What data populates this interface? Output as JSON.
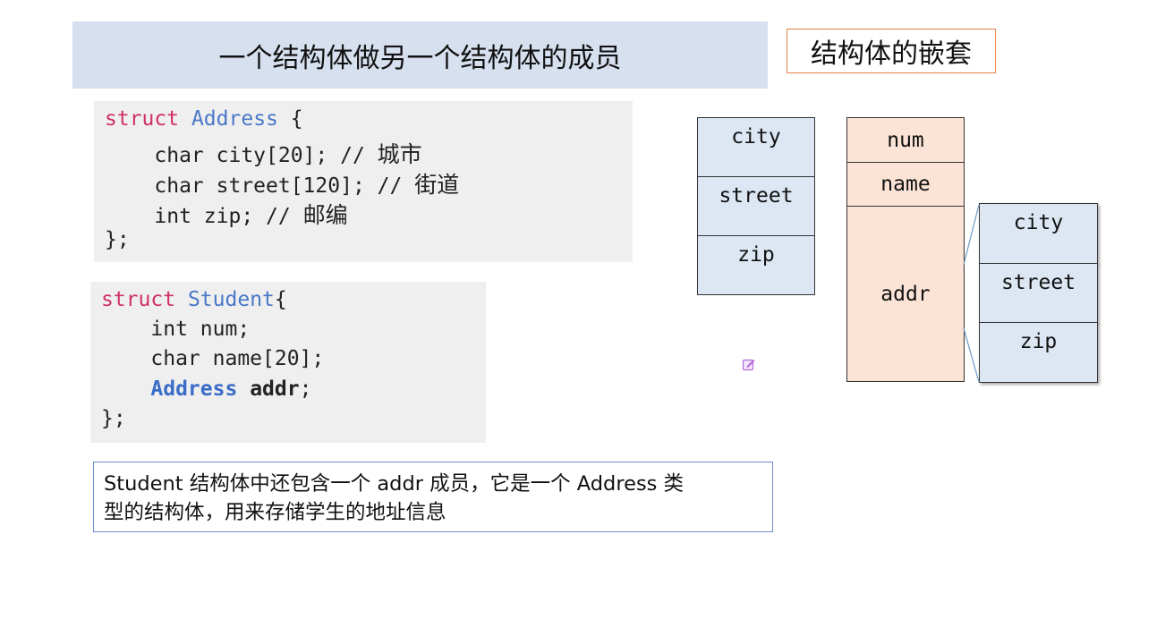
{
  "slide": {
    "title": "一个结构体做另一个结构体的成员",
    "tag": "结构体的嵌套"
  },
  "code_address": {
    "line1_kw": "struct",
    "line1_type": "Address",
    "line1_rest": " {",
    "line2": "    char city[20]; // ",
    "line2_cn": "城市",
    "line3": "    char street[120]; // ",
    "line3_cn": "街道",
    "line4": "    int zip; // ",
    "line4_cn": "邮编",
    "line5": "};"
  },
  "code_student": {
    "line1_kw": "struct",
    "line1_type": "Student",
    "line1_rest": "{",
    "line2": "    int num;",
    "line3": "    char name[20];",
    "line4_indent": "    ",
    "line4_type": "Address",
    "line4_member": "addr",
    "line4_end": ";",
    "line5": "};"
  },
  "note": {
    "line1": "Student 结构体中还包含一个 addr 成员，它是一个 Address 类",
    "line2": "型的结构体，用来存储学生的地址信息"
  },
  "diagram": {
    "address_fields": [
      "city",
      "street",
      "zip"
    ],
    "student_fields": [
      "num",
      "name",
      "addr"
    ],
    "nested_fields": [
      "city",
      "street",
      "zip"
    ]
  },
  "colors": {
    "title_bg": "#d7e0ef",
    "tag_border": "#e8804a",
    "keyword": "#d0306a",
    "type": "#4a78c8",
    "address_cell_bg": "#dce7f3",
    "student_cell_bg": "#fbe4d6"
  },
  "icons": {
    "edit": "edit-icon"
  }
}
